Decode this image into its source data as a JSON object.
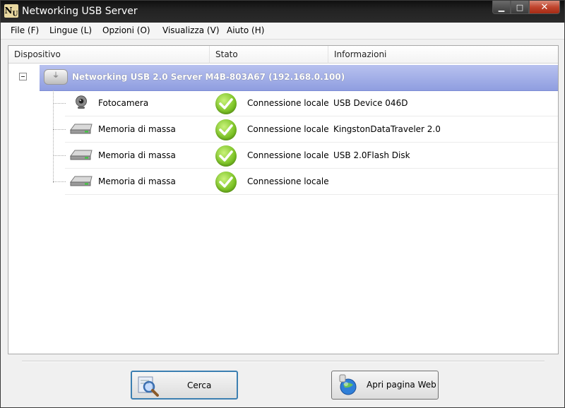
{
  "window": {
    "title": "Networking USB Server",
    "icon_letters": "N",
    "icon_sub": "U",
    "controls": {
      "minimize": "▁",
      "maximize": "□",
      "close": "✕"
    }
  },
  "menu": [
    "File (F)",
    "Lingue (L)",
    "Opzioni (O)",
    "Visualizza (V)",
    "Aiuto (H)"
  ],
  "columns": {
    "device": "Dispositivo",
    "status": "Stato",
    "info": "Informazioni"
  },
  "server": {
    "label": "Networking USB 2.0 Server M4B-803A67  (192.168.0.100)"
  },
  "devices": [
    {
      "name": "Fotocamera",
      "icon": "webcam-icon",
      "status": "Connessione locale",
      "info": "USB Device 046D"
    },
    {
      "name": "Memoria di massa",
      "icon": "drive-icon",
      "status": "Connessione locale",
      "info": "KingstonDataTraveler 2.0"
    },
    {
      "name": "Memoria di massa",
      "icon": "drive-icon",
      "status": "Connessione locale",
      "info": "USB 2.0Flash Disk"
    },
    {
      "name": "Memoria di massa",
      "icon": "drive-icon",
      "status": "Connessione locale",
      "info": ""
    }
  ],
  "buttons": {
    "search": "Cerca",
    "web": "Apri pagina Web"
  },
  "colors": {
    "selection": "#9aa8e6",
    "ok_green": "#7bc225",
    "primary_border": "#3c7fb1"
  }
}
